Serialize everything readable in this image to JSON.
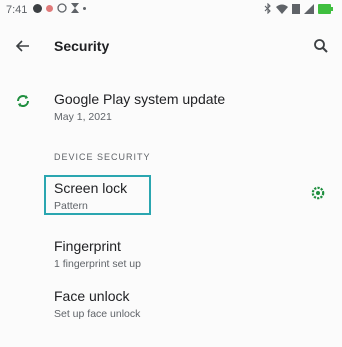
{
  "status_bar": {
    "time": "7:41"
  },
  "toolbar": {
    "title": "Security"
  },
  "google_play": {
    "title": "Google Play system update",
    "subtitle": "May 1, 2021"
  },
  "section_header": "DEVICE SECURITY",
  "items": [
    {
      "title": "Screen lock",
      "subtitle": "Pattern"
    },
    {
      "title": "Fingerprint",
      "subtitle": "1 fingerprint set up"
    },
    {
      "title": "Face unlock",
      "subtitle": "Set up face unlock"
    }
  ],
  "colors": {
    "accent": "#2aa6b0",
    "icon_green": "#1e8e3e",
    "text_primary": "#202124",
    "text_secondary": "#5f6368"
  },
  "icons": {
    "back": "back-arrow-icon",
    "search": "search-icon",
    "update": "google-play-update-icon",
    "settings": "gear-icon"
  }
}
